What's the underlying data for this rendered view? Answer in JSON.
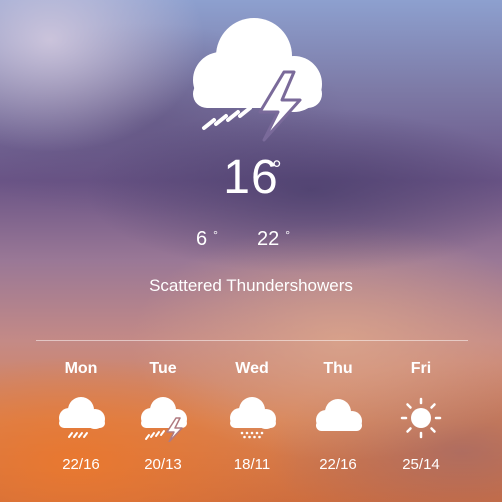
{
  "current": {
    "icon": "thunderstorm-icon",
    "temperature": "16",
    "unit": "°",
    "low": "6",
    "high": "22",
    "degree_symbol": "°",
    "condition": "Scattered Thundershowers"
  },
  "forecast": [
    {
      "day": "Mon",
      "icon": "rain-icon",
      "temps": "22/16"
    },
    {
      "day": "Tue",
      "icon": "thunderstorm-icon",
      "temps": "20/13"
    },
    {
      "day": "Wed",
      "icon": "snow-showers-icon",
      "temps": "18/11"
    },
    {
      "day": "Thu",
      "icon": "cloud-icon",
      "temps": "22/16"
    },
    {
      "day": "Fri",
      "icon": "sun-icon",
      "temps": "25/14"
    }
  ],
  "colors": {
    "text": "#ffffff",
    "background_top": "#8da0cf",
    "background_middle": "#6a5486",
    "background_bottom": "#cf6e3e"
  }
}
